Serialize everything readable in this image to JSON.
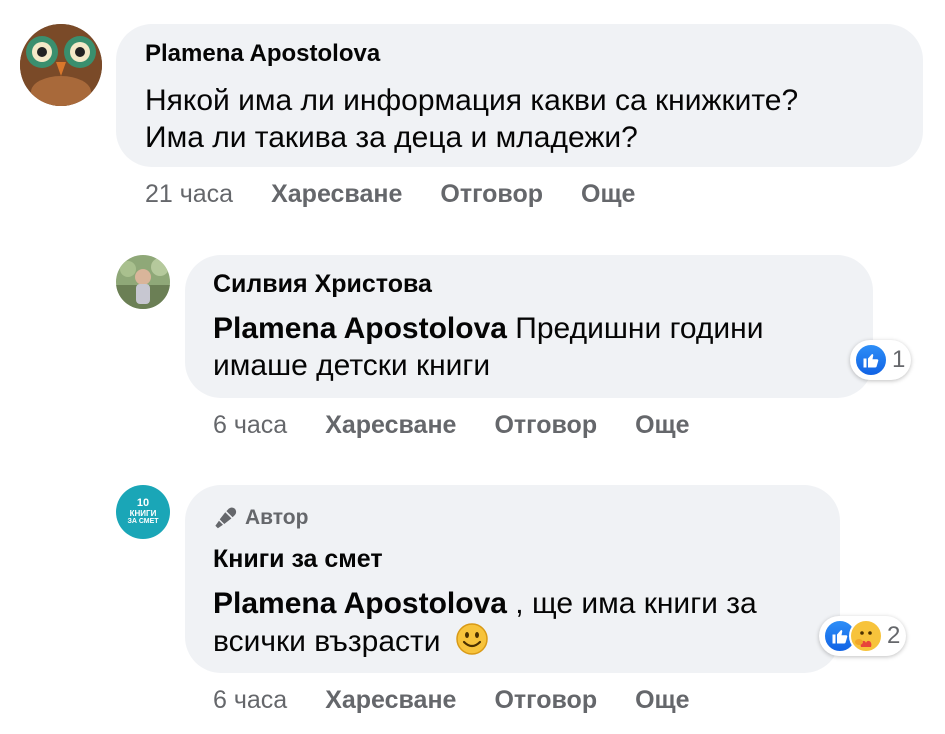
{
  "comments": [
    {
      "author": "Plamena Apostolova",
      "text_line1": "Някой има ли информация какви са книжките?",
      "text_line2": "Има ли такива за деца и младежи?",
      "time": "21 часа",
      "like": "Харесване",
      "reply": "Отговор",
      "more": "Още"
    },
    {
      "author": "Силвия Христова",
      "mention": "Plamena Apostolova",
      "text_line1_rest": " Предишни години",
      "text_line2": "имаше детски книги",
      "reactions_count": "1",
      "time": "6 часа",
      "like": "Харесване",
      "reply": "Отговор",
      "more": "Още"
    },
    {
      "badge": "Автор",
      "author": "Книги за смет",
      "mention": "Plamena Apostolova",
      "text_line1_rest": " , ще има книги за",
      "text_line2": "всички възрасти",
      "reactions_count": "2",
      "time": "6 часа",
      "like": "Харесване",
      "reply": "Отговор",
      "more": "Още"
    }
  ],
  "page_avatar_text": {
    "line1": "10",
    "line2": "КНИГИ",
    "line3": "ЗА СМЕТ"
  },
  "colors": {
    "bubble": "#f0f2f5",
    "secondary_text": "#65676b",
    "like_blue": "#1877f2",
    "page_avatar": "#1aa6b7"
  }
}
